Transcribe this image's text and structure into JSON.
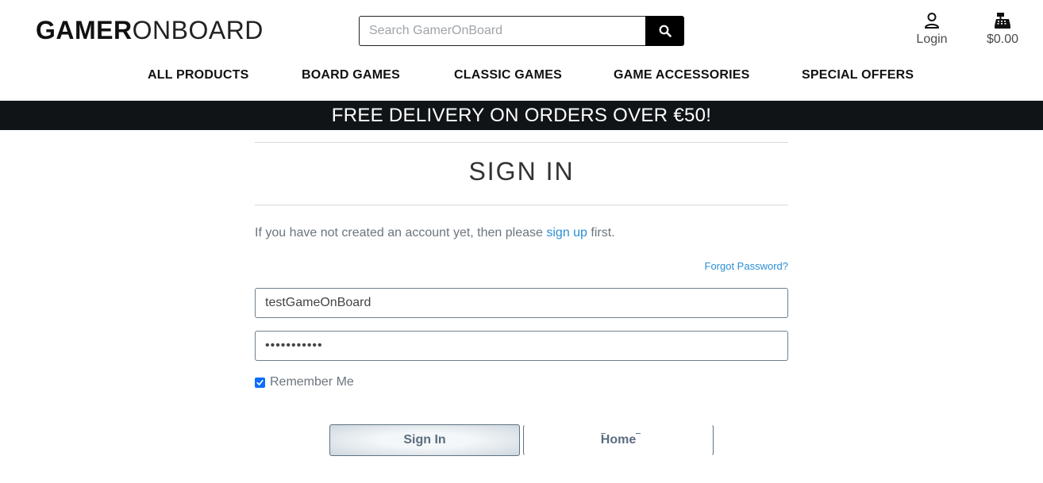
{
  "header": {
    "logo_bold": "GAMER",
    "logo_light": "ONBOARD",
    "search_placeholder": "Search GamerOnBoard",
    "account_label": "Login",
    "cart_total": "$0.00"
  },
  "nav": {
    "items": [
      "ALL PRODUCTS",
      "BOARD GAMES",
      "CLASSIC GAMES",
      "GAME ACCESSORIES",
      "SPECIAL OFFERS"
    ]
  },
  "banner": {
    "text": "FREE DELIVERY ON ORDERS OVER €50!"
  },
  "signin": {
    "title": "SIGN IN",
    "intro_before": "If you have not created an account yet, then please ",
    "signup_link": "sign up",
    "intro_after": " first.",
    "forgot_password": "Forgot Password?",
    "username_value": "testGameOnBoard",
    "password_value": "•••••••••••",
    "remember_label": "Remember Me",
    "remember_checked": true,
    "signin_button": "Sign In",
    "home_button": "Home"
  },
  "colors": {
    "banner_bg": "#111417",
    "link": "#2b8fd6",
    "checkbox": "#0d6efd",
    "button_text": "#5a6d7f"
  }
}
